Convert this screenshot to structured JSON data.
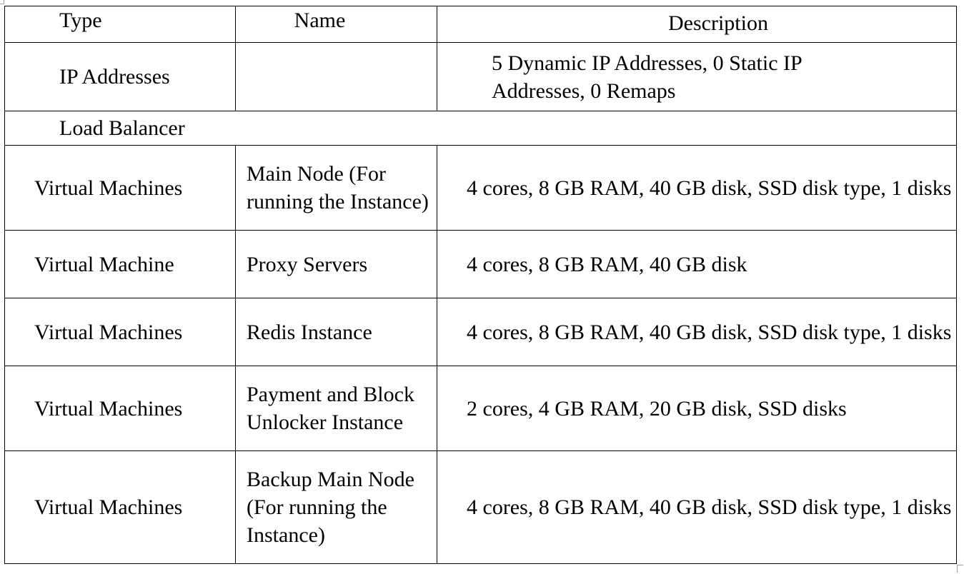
{
  "table": {
    "headers": {
      "type": "Type",
      "name": "Name",
      "description": "Description"
    },
    "rows": [
      {
        "type": "IP Addresses",
        "name": "",
        "description": "5 Dynamic IP Addresses, 0 Static IP Addresses, 0 Remaps"
      },
      {
        "type": "Load Balancer",
        "name": "",
        "description": ""
      },
      {
        "type": "Virtual Machines",
        "name": "Main Node (For running the Instance)",
        "description": "4 cores, 8 GB RAM, 40 GB disk, SSD disk type, 1 disks"
      },
      {
        "type": "Virtual Machine",
        "name": "Proxy Servers",
        "description": "4 cores, 8 GB RAM, 40 GB disk"
      },
      {
        "type": "Virtual Machines",
        "name": "Redis Instance",
        "description": "4 cores, 8 GB RAM, 40 GB disk, SSD disk type, 1 disks"
      },
      {
        "type": "Virtual Machines",
        "name": "Payment and Block Unlocker Instance",
        "description": "2 cores, 4 GB RAM, 20 GB disk, SSD disks"
      },
      {
        "type": "Virtual Machines",
        "name": "Backup Main Node (For running the Instance)",
        "description": "4 cores, 8 GB RAM, 40 GB disk, SSD disk type, 1 disks"
      }
    ]
  }
}
